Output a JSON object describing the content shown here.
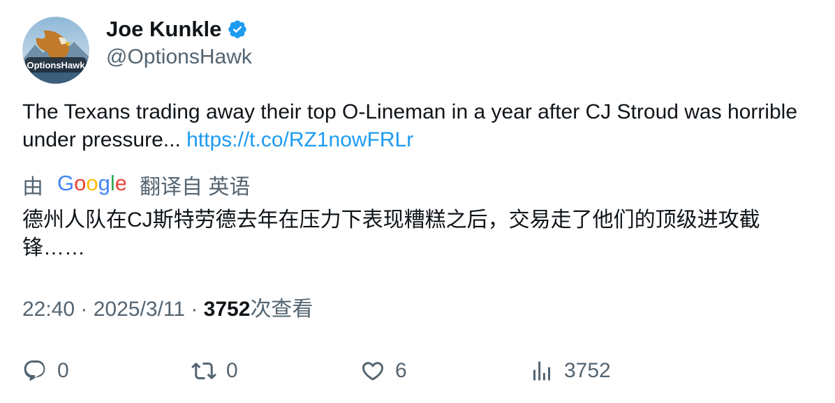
{
  "author": {
    "display_name": "Joe Kunkle",
    "handle": "@OptionsHawk",
    "verified": true,
    "avatar_text": "OptionsHawk"
  },
  "tweet": {
    "text": "The Texans trading away their top O-Lineman in a year after CJ Stroud was horrible under pressure... ",
    "link": "https://t.co/RZ1nowFRLr"
  },
  "translation": {
    "by_label": "由",
    "provider": "Google",
    "from_label": "翻译自 英语",
    "text": "德州人队在CJ斯特劳德去年在压力下表现糟糕之后，交易走了他们的顶级进攻截锋……"
  },
  "meta": {
    "time": "22:40",
    "separator": " · ",
    "date": "2025/3/11",
    "views_count": "3752",
    "views_label": "次查看"
  },
  "actions": {
    "reply_count": "0",
    "retweet_count": "0",
    "like_count": "6",
    "views_count": "3752"
  },
  "colors": {
    "verified_badge": "#1d9bf0",
    "link": "#1d9bf0",
    "secondary_text": "#536471"
  }
}
